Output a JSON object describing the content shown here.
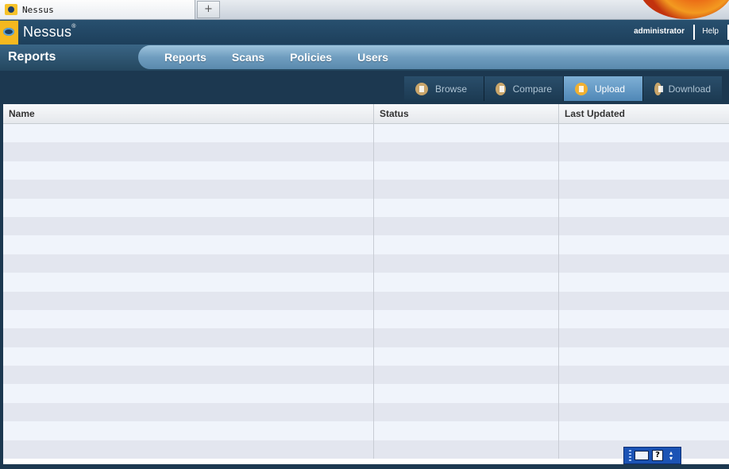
{
  "browser": {
    "tab_title": "Nessus",
    "new_tab_symbol": "+"
  },
  "header": {
    "logo_text": "Nessus",
    "logo_mark": "®",
    "user": "administrator",
    "help": "Help"
  },
  "section": {
    "title": "Reports"
  },
  "nav": {
    "items": [
      {
        "label": "Reports"
      },
      {
        "label": "Scans"
      },
      {
        "label": "Policies"
      },
      {
        "label": "Users"
      }
    ]
  },
  "toolbar": {
    "buttons": [
      {
        "label": "Browse",
        "icon": "browse-icon",
        "active": false
      },
      {
        "label": "Compare",
        "icon": "compare-icon",
        "active": false
      },
      {
        "label": "Upload",
        "icon": "upload-icon",
        "active": true
      },
      {
        "label": "Download",
        "icon": "download-icon",
        "active": false
      }
    ]
  },
  "table": {
    "columns": [
      "Name",
      "Status",
      "Last Updated"
    ],
    "rows": []
  },
  "ime": {
    "help_symbol": "?"
  },
  "colors": {
    "app_background": "#1c3850",
    "nav_pill": "#6f9dbf",
    "active_button": "#4f87b6",
    "row_odd": "#f0f4fb",
    "row_even": "#e3e6ef"
  }
}
